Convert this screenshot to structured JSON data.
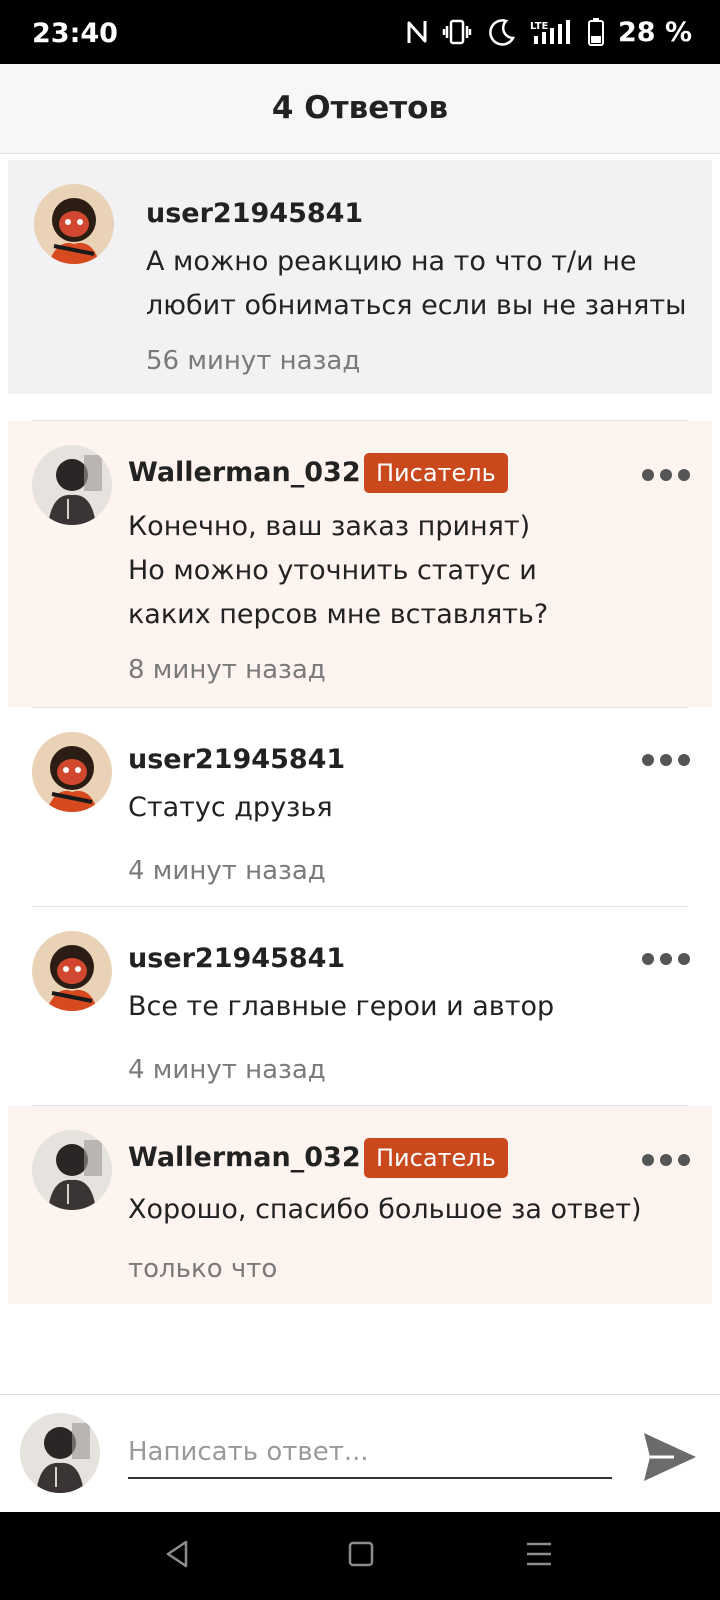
{
  "status_bar": {
    "time": "23:40",
    "battery": "28 %",
    "icons": [
      "nfc-icon",
      "vibrate-icon",
      "moon-icon",
      "lte-signal-icon",
      "battery-icon"
    ]
  },
  "header": {
    "title": "4 Ответов"
  },
  "parent_comment": {
    "username": "user21945841",
    "text": "А можно реакцию на то что т/и не любит обниматься если вы не заняты",
    "time": "56 минут назад"
  },
  "replies": [
    {
      "username": "Wallerman_032",
      "badge": "Писатель",
      "line1": "Конечно, ваш заказ принят)",
      "line2": "Но можно уточнить статус и каких персов мне вставлять?",
      "time": "8 минут назад"
    },
    {
      "username": "user21945841",
      "text": "Статус друзья",
      "time": "4 минут назад"
    },
    {
      "username": "user21945841",
      "text": "Все те главные герои и автор",
      "time": "4 минут назад"
    },
    {
      "username": "Wallerman_032",
      "badge": "Писатель",
      "text": "Хорошо, спасибо большое за ответ)",
      "time": "только что"
    }
  ],
  "reply_bar": {
    "placeholder": "Написать ответ..."
  },
  "colors": {
    "badge": "#c9491d",
    "highlight_bg": "#fdf3ef",
    "parent_bg": "#f2f2f5"
  }
}
